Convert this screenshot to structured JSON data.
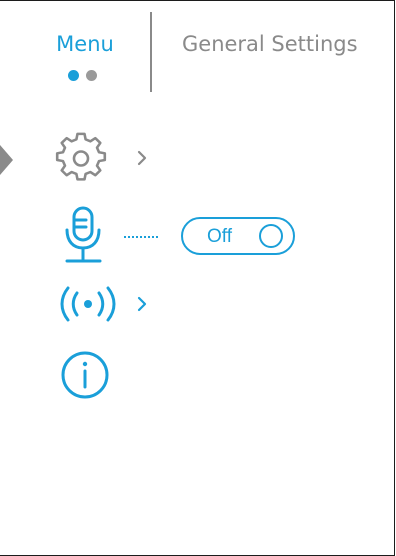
{
  "header": {
    "menu_title": "Menu",
    "settings_title": "General Settings",
    "page_indicator": {
      "pages": 2,
      "active": 1
    }
  },
  "menu_items": [
    {
      "icon": "gear-icon",
      "has_submenu": true,
      "selected": true
    },
    {
      "icon": "microphone-icon",
      "toggle": {
        "label": "Off",
        "state": "off"
      }
    },
    {
      "icon": "broadcast-icon",
      "has_submenu": true
    },
    {
      "icon": "info-icon"
    }
  ],
  "colors": {
    "accent": "#1a9fd9",
    "inactive": "#8a8a8a",
    "frame": "#1c1c1c",
    "background": "#ffffff"
  }
}
